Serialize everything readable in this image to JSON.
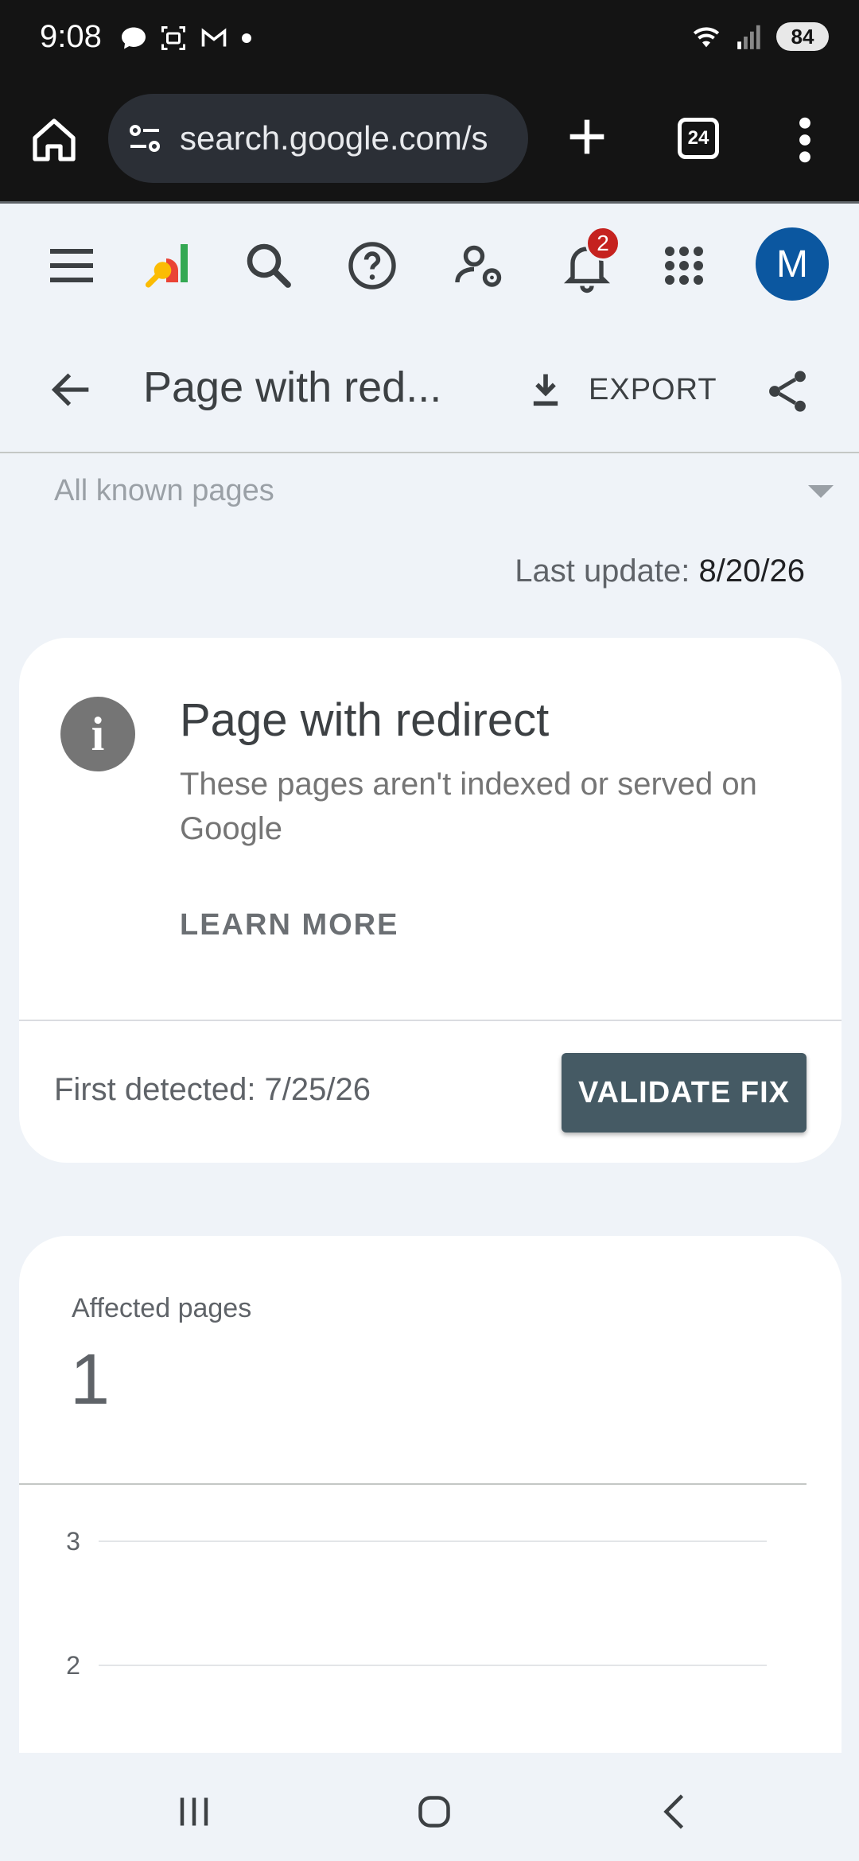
{
  "status_bar": {
    "time": "9:08",
    "battery": "84",
    "signal_label": "6"
  },
  "browser": {
    "url": "search.google.com/s",
    "tab_count": "24"
  },
  "header": {
    "notification_count": "2",
    "avatar_letter": "M"
  },
  "title_bar": {
    "title": "Page with red...",
    "export_label": "EXPORT"
  },
  "filter": {
    "label": "All known pages"
  },
  "last_update": {
    "label": "Last update:",
    "value": "8/20/26"
  },
  "issue_card": {
    "title": "Page with redirect",
    "description": "These pages aren't indexed or served on Google",
    "learn_more": "LEARN MORE",
    "first_detected": "First detected: 7/25/26",
    "validate_label": "VALIDATE FIX"
  },
  "affected_card": {
    "label": "Affected pages",
    "value": "1"
  },
  "chart_data": {
    "type": "line",
    "y_ticks": [
      "3",
      "2"
    ],
    "ylim": [
      2,
      3
    ]
  },
  "colors": {
    "validate_button": "#455a64",
    "avatar": "#0b57a0",
    "badge": "#c5221f"
  }
}
